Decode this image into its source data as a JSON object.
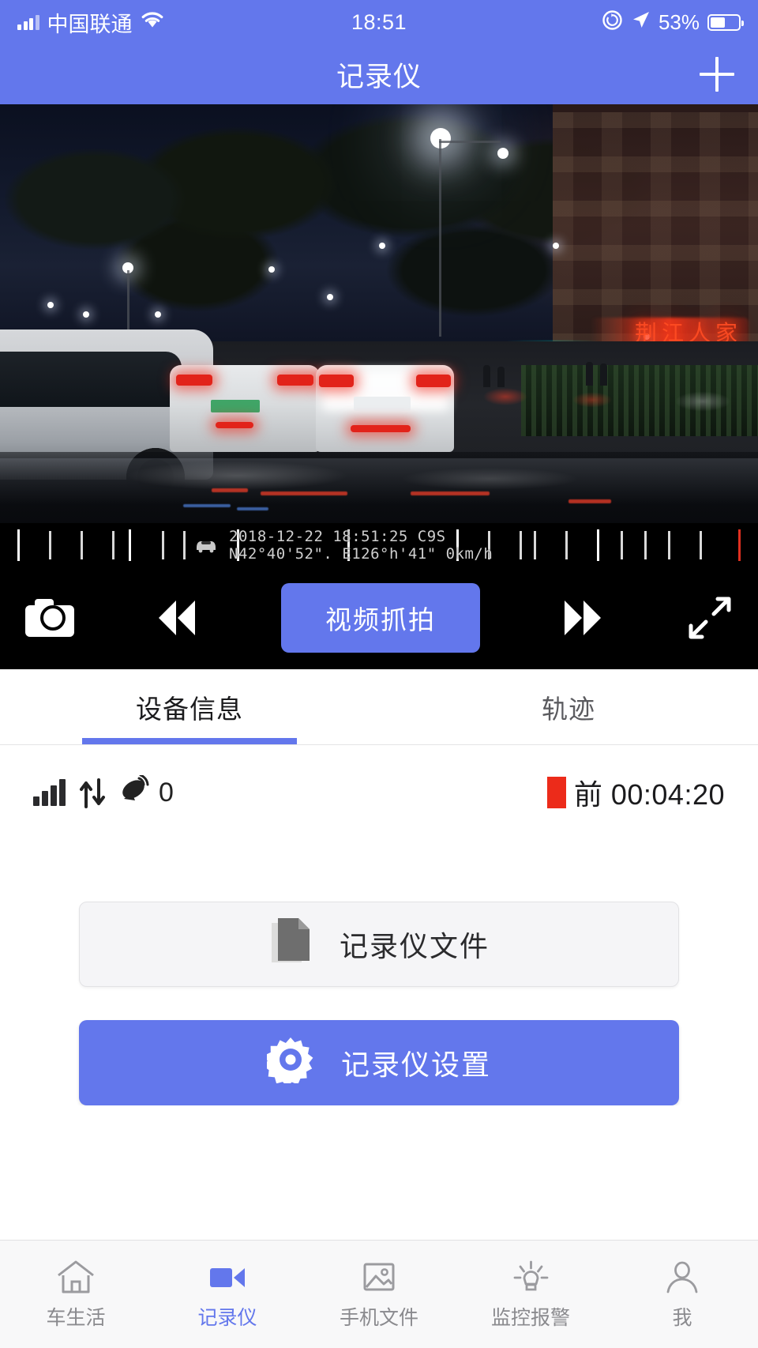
{
  "status_bar": {
    "carrier": "中国联通",
    "time": "18:51",
    "battery_percent": "53%",
    "signal_icon": "signal-bars-icon",
    "wifi_icon": "wifi-icon",
    "lock_rotation_icon": "rotation-lock-icon",
    "location_icon": "location-arrow-icon",
    "battery_icon": "battery-icon"
  },
  "nav": {
    "title": "记录仪",
    "add_label": "+"
  },
  "video": {
    "osd_line1": "2018-12-22 18:51:25 C9S",
    "osd_line2": "N42°40'52\". E126°h'41\" 0km/h",
    "osd_car_icon": "car-icon",
    "neon_sign_text": "荆江人家"
  },
  "controls": {
    "capture_photo_icon": "camera-icon",
    "rewind_icon": "rewind-icon",
    "snapshot_label": "视频抓拍",
    "forward_icon": "fast-forward-icon",
    "fullscreen_icon": "expand-icon"
  },
  "tabs": [
    {
      "label": "设备信息",
      "active": true
    },
    {
      "label": "轨迹",
      "active": false
    }
  ],
  "device_status": {
    "signal_icon": "signal-bars-icon",
    "traffic_icon": "up-down-arrows-icon",
    "satellite_icon": "satellite-dish-icon",
    "satellite_count": "0",
    "recording_indicator_icon": "record-square-icon",
    "recording_label": "前 00:04:20"
  },
  "actions": {
    "files_label": "记录仪文件",
    "files_icon": "document-icon",
    "settings_label": "记录仪设置",
    "settings_icon": "gear-icon"
  },
  "bottom_tabs": [
    {
      "label": "车生活",
      "icon": "home-icon",
      "active": false
    },
    {
      "label": "记录仪",
      "icon": "video-camera-icon",
      "active": true
    },
    {
      "label": "手机文件",
      "icon": "photo-icon",
      "active": false
    },
    {
      "label": "监控报警",
      "icon": "lightbulb-icon",
      "active": false
    },
    {
      "label": "我",
      "icon": "person-icon",
      "active": false
    }
  ],
  "colors": {
    "accent": "#6377ec",
    "recording_red": "#ec2b1a",
    "inactive_gray": "#8a8a8e"
  }
}
